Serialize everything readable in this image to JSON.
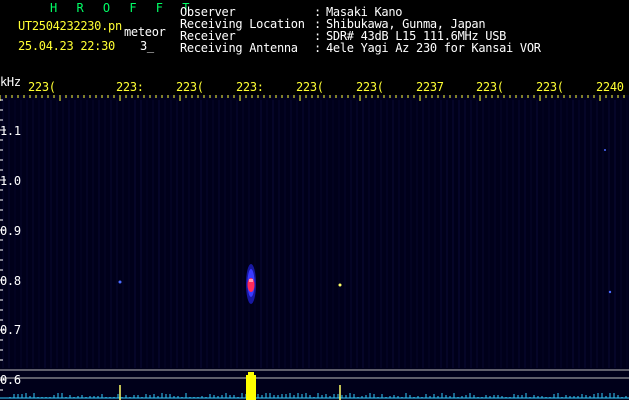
{
  "header": {
    "brand": "H R O F F T",
    "filename": "UT2504232230.pn",
    "mode": "meteor",
    "datetime": "25.04.23 22:30",
    "counter": "3_"
  },
  "info": {
    "observer_label": "Observer",
    "location_label": "Receiving Location",
    "receiver_label": "Receiver",
    "antenna_label": "Receiving Antenna",
    "sep": ":",
    "observer": "Masaki Kano",
    "location": "Shibukawa, Gunma, Japan",
    "receiver": "SDR# 43dB L15 111.6MHz USB",
    "antenna": "4ele Yagi Az 230 for Kansai VOR"
  },
  "axes": {
    "y_unit": "kHz",
    "y_ticks": [
      "1.1",
      "1.0",
      "0.9",
      "0.8",
      "0.7",
      "0.6"
    ],
    "x_ticks": [
      "223(",
      "223:",
      "223(",
      "223:",
      "223(",
      "223(",
      "2237",
      "223(",
      "223(",
      "2240"
    ]
  },
  "colors": {
    "background": "#000000",
    "frame_text": "#ffffff",
    "tick_labels": "#ffff33",
    "brand": "#00ff66",
    "meteor_echo_core": "#ff2a5a",
    "meteor_echo_halo": "#3a3aff",
    "baseline_marker": "#ffff00",
    "noise_trace": "#33ccff"
  }
}
